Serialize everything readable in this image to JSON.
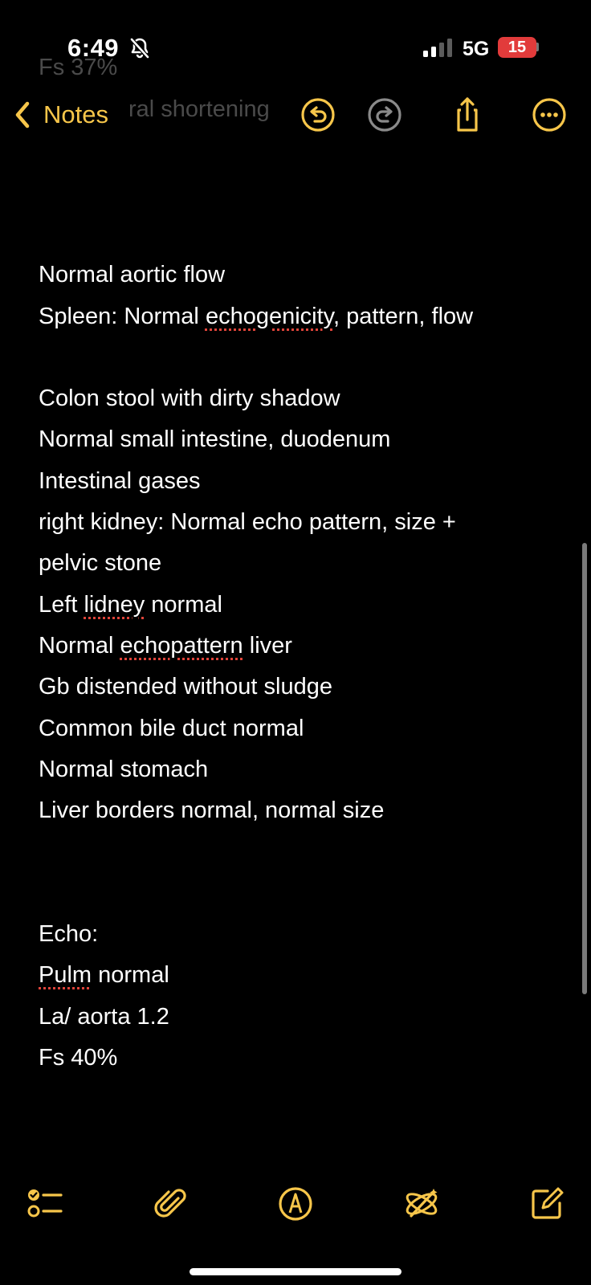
{
  "status_bar": {
    "time": "6:49",
    "network": "5G",
    "battery": "15"
  },
  "ghost_text": {
    "line1": "Fs 37%",
    "line2": "ral shortening"
  },
  "nav": {
    "back_label": "Notes",
    "accent_color": "#f7c64a",
    "icons": [
      "undo-icon",
      "redo-icon",
      "share-icon",
      "more-icon"
    ]
  },
  "note": {
    "lines": [
      "",
      "Normal aortic flow",
      "Spleen: Normal echogenicity, pattern, flow",
      "",
      "Colon stool with dirty shadow",
      "Normal small intestine, duodenum",
      "Intestinal gases",
      "right kidney: Normal echo pattern, size +",
      "pelvic stone",
      "Left lidney normal",
      "Normal echopattern liver",
      "Gb distended without sludge",
      "Common bile duct normal",
      "Normal stomach",
      "Liver borders normal, normal size",
      "",
      "",
      "Echo:",
      "Pulm normal",
      "La/ aorta 1.2",
      "Fs 40%"
    ],
    "misspelled": [
      "echogenicity",
      "lidney",
      "echopattern",
      "Pulm"
    ]
  },
  "toolbar": {
    "icons": [
      "checklist-icon",
      "attachment-icon",
      "markup-icon",
      "writing-tools-icon",
      "compose-icon"
    ]
  }
}
